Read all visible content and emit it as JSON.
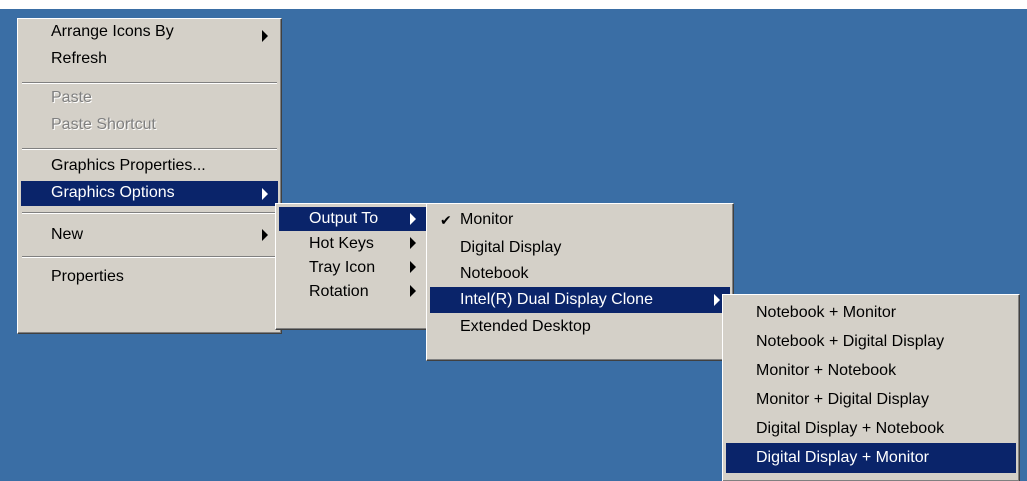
{
  "main_menu": {
    "items": [
      {
        "label": "Arrange Icons By"
      },
      {
        "label": "Refresh"
      },
      {
        "label": "Paste"
      },
      {
        "label": "Paste Shortcut"
      },
      {
        "label": "Graphics Properties..."
      },
      {
        "label": "Graphics Options"
      },
      {
        "label": "New"
      },
      {
        "label": "Properties"
      }
    ]
  },
  "graphics_options_menu": {
    "items": [
      {
        "label": "Output To"
      },
      {
        "label": "Hot Keys"
      },
      {
        "label": "Tray Icon"
      },
      {
        "label": "Rotation"
      }
    ]
  },
  "output_to_menu": {
    "items": [
      {
        "label": "Monitor",
        "checked": true
      },
      {
        "label": "Digital Display"
      },
      {
        "label": "Notebook"
      },
      {
        "label": "Intel(R) Dual Display Clone"
      },
      {
        "label": "Extended Desktop"
      }
    ],
    "check_glyph": "✔"
  },
  "clone_menu": {
    "items": [
      {
        "label": "Notebook + Monitor"
      },
      {
        "label": "Notebook + Digital Display"
      },
      {
        "label": "Monitor + Notebook"
      },
      {
        "label": "Monitor + Digital Display"
      },
      {
        "label": "Digital Display + Notebook"
      },
      {
        "label": "Digital Display + Monitor"
      }
    ]
  },
  "colors": {
    "desktop": "#3a6ea5",
    "menu_face": "#d4d0c8",
    "highlight": "#0a246a",
    "disabled_text": "#808080"
  }
}
